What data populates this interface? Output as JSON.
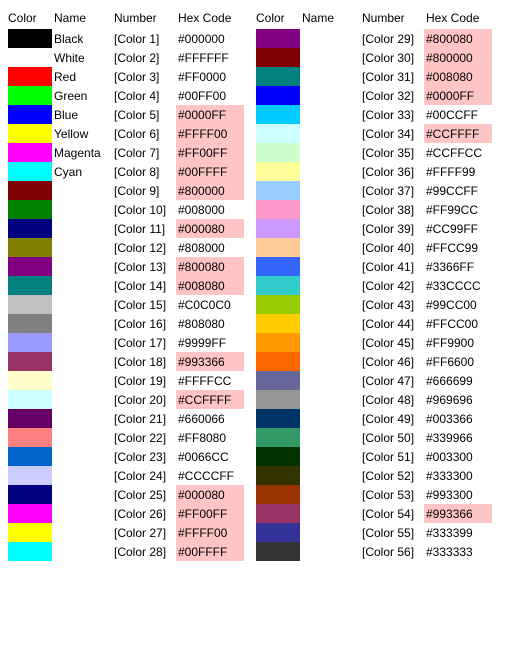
{
  "headers": {
    "color": "Color",
    "name": "Name",
    "number": "Number",
    "hex": "Hex Code"
  },
  "left": [
    {
      "swatch": "#000000",
      "name": "Black",
      "number": "[Color 1]",
      "hex": "#000000",
      "hl": false
    },
    {
      "swatch": "#FFFFFF",
      "name": "White",
      "number": "[Color 2]",
      "hex": "#FFFFFF",
      "hl": false
    },
    {
      "swatch": "#FF0000",
      "name": "Red",
      "number": "[Color 3]",
      "hex": "#FF0000",
      "hl": false
    },
    {
      "swatch": "#00FF00",
      "name": "Green",
      "number": "[Color 4]",
      "hex": "#00FF00",
      "hl": false
    },
    {
      "swatch": "#0000FF",
      "name": "Blue",
      "number": "[Color 5]",
      "hex": "#0000FF",
      "hl": true
    },
    {
      "swatch": "#FFFF00",
      "name": "Yellow",
      "number": "[Color 6]",
      "hex": "#FFFF00",
      "hl": true
    },
    {
      "swatch": "#FF00FF",
      "name": "Magenta",
      "number": "[Color 7]",
      "hex": "#FF00FF",
      "hl": true
    },
    {
      "swatch": "#00FFFF",
      "name": "Cyan",
      "number": "[Color 8]",
      "hex": "#00FFFF",
      "hl": true
    },
    {
      "swatch": "#800000",
      "name": "",
      "number": "[Color 9]",
      "hex": "#800000",
      "hl": true
    },
    {
      "swatch": "#008000",
      "name": "",
      "number": "[Color 10]",
      "hex": "#008000",
      "hl": false
    },
    {
      "swatch": "#000080",
      "name": "",
      "number": "[Color 11]",
      "hex": "#000080",
      "hl": true
    },
    {
      "swatch": "#808000",
      "name": "",
      "number": "[Color 12]",
      "hex": "#808000",
      "hl": false
    },
    {
      "swatch": "#800080",
      "name": "",
      "number": "[Color 13]",
      "hex": "#800080",
      "hl": true
    },
    {
      "swatch": "#008080",
      "name": "",
      "number": "[Color 14]",
      "hex": "#008080",
      "hl": true
    },
    {
      "swatch": "#C0C0C0",
      "name": "",
      "number": "[Color 15]",
      "hex": "#C0C0C0",
      "hl": false
    },
    {
      "swatch": "#808080",
      "name": "",
      "number": "[Color 16]",
      "hex": "#808080",
      "hl": false
    },
    {
      "swatch": "#9999FF",
      "name": "",
      "number": "[Color 17]",
      "hex": "#9999FF",
      "hl": false
    },
    {
      "swatch": "#993366",
      "name": "",
      "number": "[Color 18]",
      "hex": "#993366",
      "hl": true
    },
    {
      "swatch": "#FFFFCC",
      "name": "",
      "number": "[Color 19]",
      "hex": "#FFFFCC",
      "hl": false
    },
    {
      "swatch": "#CCFFFF",
      "name": "",
      "number": "[Color 20]",
      "hex": "#CCFFFF",
      "hl": true
    },
    {
      "swatch": "#660066",
      "name": "",
      "number": "[Color 21]",
      "hex": "#660066",
      "hl": false
    },
    {
      "swatch": "#FF8080",
      "name": "",
      "number": "[Color 22]",
      "hex": "#FF8080",
      "hl": false
    },
    {
      "swatch": "#0066CC",
      "name": "",
      "number": "[Color 23]",
      "hex": "#0066CC",
      "hl": false
    },
    {
      "swatch": "#CCCCFF",
      "name": "",
      "number": "[Color 24]",
      "hex": "#CCCCFF",
      "hl": false
    },
    {
      "swatch": "#000080",
      "name": "",
      "number": "[Color 25]",
      "hex": "#000080",
      "hl": true
    },
    {
      "swatch": "#FF00FF",
      "name": "",
      "number": "[Color 26]",
      "hex": "#FF00FF",
      "hl": true
    },
    {
      "swatch": "#FFFF00",
      "name": "",
      "number": "[Color 27]",
      "hex": "#FFFF00",
      "hl": true
    },
    {
      "swatch": "#00FFFF",
      "name": "",
      "number": "[Color 28]",
      "hex": "#00FFFF",
      "hl": true
    }
  ],
  "right": [
    {
      "swatch": "#800080",
      "name": "",
      "number": "[Color 29]",
      "hex": "#800080",
      "hl": true
    },
    {
      "swatch": "#800000",
      "name": "",
      "number": "[Color 30]",
      "hex": "#800000",
      "hl": true
    },
    {
      "swatch": "#008080",
      "name": "",
      "number": "[Color 31]",
      "hex": "#008080",
      "hl": true
    },
    {
      "swatch": "#0000FF",
      "name": "",
      "number": "[Color 32]",
      "hex": "#0000FF",
      "hl": true
    },
    {
      "swatch": "#00CCFF",
      "name": "",
      "number": "[Color 33]",
      "hex": "#00CCFF",
      "hl": false
    },
    {
      "swatch": "#CCFFFF",
      "name": "",
      "number": "[Color 34]",
      "hex": "#CCFFFF",
      "hl": true
    },
    {
      "swatch": "#CCFFCC",
      "name": "",
      "number": "[Color 35]",
      "hex": "#CCFFCC",
      "hl": false
    },
    {
      "swatch": "#FFFF99",
      "name": "",
      "number": "[Color 36]",
      "hex": "#FFFF99",
      "hl": false
    },
    {
      "swatch": "#99CCFF",
      "name": "",
      "number": "[Color 37]",
      "hex": "#99CCFF",
      "hl": false
    },
    {
      "swatch": "#FF99CC",
      "name": "",
      "number": "[Color 38]",
      "hex": "#FF99CC",
      "hl": false
    },
    {
      "swatch": "#CC99FF",
      "name": "",
      "number": "[Color 39]",
      "hex": "#CC99FF",
      "hl": false
    },
    {
      "swatch": "#FFCC99",
      "name": "",
      "number": "[Color 40]",
      "hex": "#FFCC99",
      "hl": false
    },
    {
      "swatch": "#3366FF",
      "name": "",
      "number": "[Color 41]",
      "hex": "#3366FF",
      "hl": false
    },
    {
      "swatch": "#33CCCC",
      "name": "",
      "number": "[Color 42]",
      "hex": "#33CCCC",
      "hl": false
    },
    {
      "swatch": "#99CC00",
      "name": "",
      "number": "[Color 43]",
      "hex": "#99CC00",
      "hl": false
    },
    {
      "swatch": "#FFCC00",
      "name": "",
      "number": "[Color 44]",
      "hex": "#FFCC00",
      "hl": false
    },
    {
      "swatch": "#FF9900",
      "name": "",
      "number": "[Color 45]",
      "hex": "#FF9900",
      "hl": false
    },
    {
      "swatch": "#FF6600",
      "name": "",
      "number": "[Color 46]",
      "hex": "#FF6600",
      "hl": false
    },
    {
      "swatch": "#666699",
      "name": "",
      "number": "[Color 47]",
      "hex": "#666699",
      "hl": false
    },
    {
      "swatch": "#969696",
      "name": "",
      "number": "[Color 48]",
      "hex": "#969696",
      "hl": false
    },
    {
      "swatch": "#003366",
      "name": "",
      "number": "[Color 49]",
      "hex": "#003366",
      "hl": false
    },
    {
      "swatch": "#339966",
      "name": "",
      "number": "[Color 50]",
      "hex": "#339966",
      "hl": false
    },
    {
      "swatch": "#003300",
      "name": "",
      "number": "[Color 51]",
      "hex": "#003300",
      "hl": false
    },
    {
      "swatch": "#333300",
      "name": "",
      "number": "[Color 52]",
      "hex": "#333300",
      "hl": false
    },
    {
      "swatch": "#993300",
      "name": "",
      "number": "[Color 53]",
      "hex": "#993300",
      "hl": false
    },
    {
      "swatch": "#993366",
      "name": "",
      "number": "[Color 54]",
      "hex": "#993366",
      "hl": true
    },
    {
      "swatch": "#333399",
      "name": "",
      "number": "[Color 55]",
      "hex": "#333399",
      "hl": false
    },
    {
      "swatch": "#333333",
      "name": "",
      "number": "[Color 56]",
      "hex": "#333333",
      "hl": false
    }
  ]
}
